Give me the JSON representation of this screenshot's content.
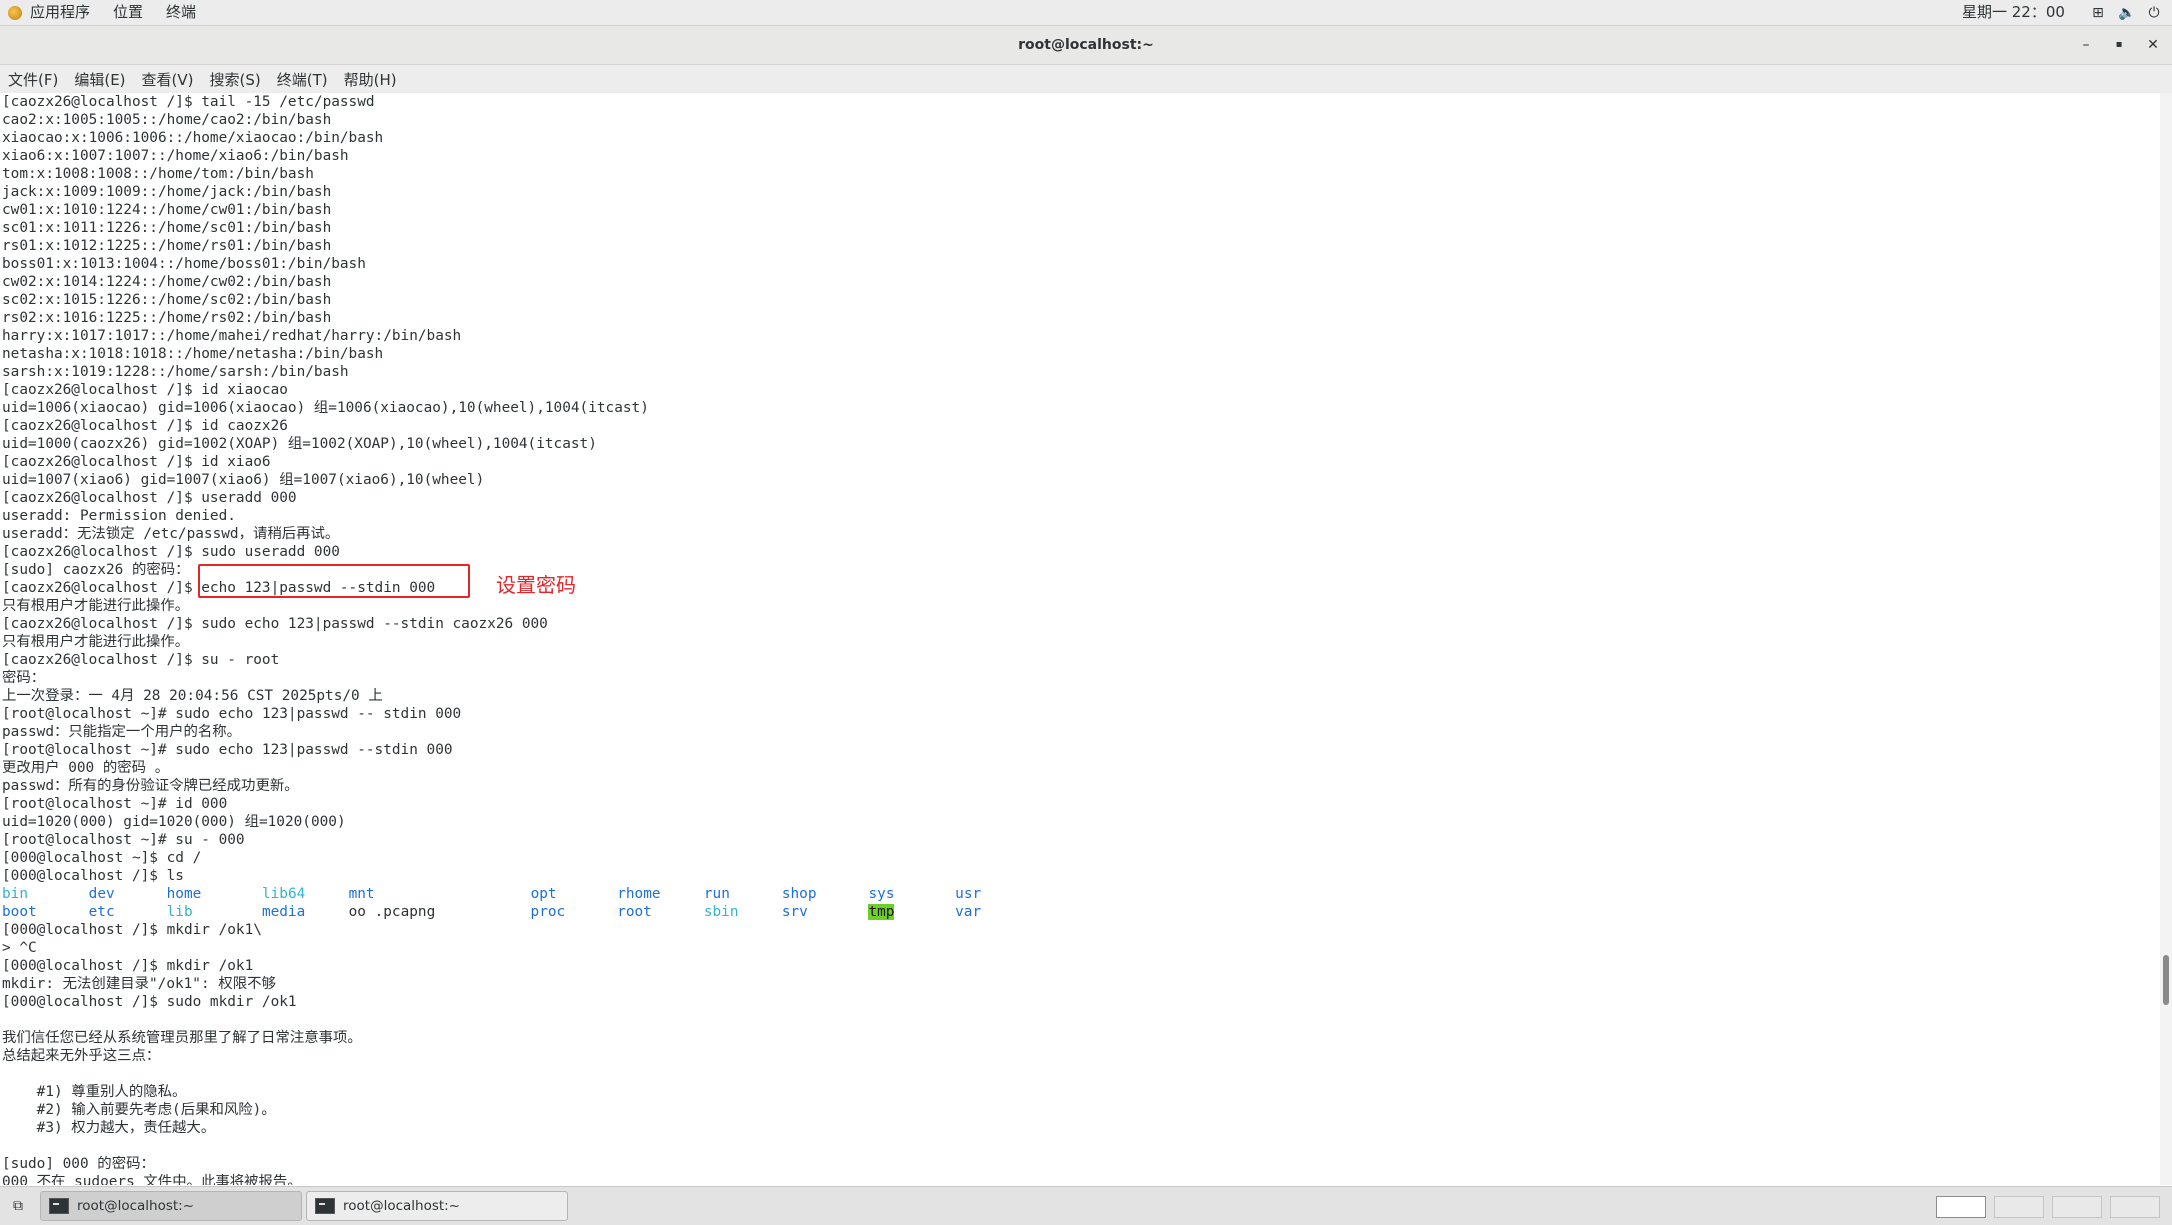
{
  "topbar": {
    "apps_label": "应用程序",
    "places_label": "位置",
    "terminal_label": "终端",
    "clock": "星期一 22：00",
    "tray_icons": [
      "network-icon",
      "volume-icon",
      "power-icon"
    ]
  },
  "window": {
    "title": "root@localhost:~",
    "buttons": {
      "minimize": "–",
      "maximize": "▪",
      "close": "✕"
    }
  },
  "menubar": {
    "items": [
      "文件(F)",
      "编辑(E)",
      "查看(V)",
      "搜索(S)",
      "终端(T)",
      "帮助(H)"
    ]
  },
  "terminal": {
    "lines_before_ls": [
      "[caozx26@localhost /]$ tail -15 /etc/passwd",
      "cao2:x:1005:1005::/home/cao2:/bin/bash",
      "xiaocao:x:1006:1006::/home/xiaocao:/bin/bash",
      "xiao6:x:1007:1007::/home/xiao6:/bin/bash",
      "tom:x:1008:1008::/home/tom:/bin/bash",
      "jack:x:1009:1009::/home/jack:/bin/bash",
      "cw01:x:1010:1224::/home/cw01:/bin/bash",
      "sc01:x:1011:1226::/home/sc01:/bin/bash",
      "rs01:x:1012:1225::/home/rs01:/bin/bash",
      "boss01:x:1013:1004::/home/boss01:/bin/bash",
      "cw02:x:1014:1224::/home/cw02:/bin/bash",
      "sc02:x:1015:1226::/home/sc02:/bin/bash",
      "rs02:x:1016:1225::/home/rs02:/bin/bash",
      "harry:x:1017:1017::/home/mahei/redhat/harry:/bin/bash",
      "netasha:x:1018:1018::/home/netasha:/bin/bash",
      "sarsh:x:1019:1228::/home/sarsh:/bin/bash",
      "[caozx26@localhost /]$ id xiaocao",
      "uid=1006(xiaocao) gid=1006(xiaocao) 组=1006(xiaocao),10(wheel),1004(itcast)",
      "[caozx26@localhost /]$ id caozx26",
      "uid=1000(caozx26) gid=1002(XOAP) 组=1002(XOAP),10(wheel),1004(itcast)",
      "[caozx26@localhost /]$ id xiao6",
      "uid=1007(xiao6) gid=1007(xiao6) 组=1007(xiao6),10(wheel)",
      "[caozx26@localhost /]$ useradd 000",
      "useradd: Permission denied.",
      "useradd：无法锁定 /etc/passwd，请稍后再试。",
      "[caozx26@localhost /]$ sudo useradd 000",
      "[sudo] caozx26 的密码：",
      "[caozx26@localhost /]$ echo 123|passwd --stdin 000",
      "只有根用户才能进行此操作。",
      "[caozx26@localhost /]$ sudo echo 123|passwd --stdin caozx26 000",
      "只有根用户才能进行此操作。",
      "[caozx26@localhost /]$ su - root",
      "密码：",
      "上一次登录：一 4月 28 20:04:56 CST 2025pts/0 上",
      "[root@localhost ~]# sudo echo 123|passwd -- stdin 000",
      "passwd：只能指定一个用户的名称。",
      "[root@localhost ~]# sudo echo 123|passwd --stdin 000",
      "更改用户 000 的密码 。",
      "passwd：所有的身份验证令牌已经成功更新。",
      "[root@localhost ~]# id 000",
      "uid=1020(000) gid=1020(000) 组=1020(000)",
      "[root@localhost ~]# su - 000",
      "[000@localhost ~]$ cd /",
      "[000@localhost /]$ ls"
    ],
    "ls_row1": [
      {
        "name": "bin",
        "kind": "link"
      },
      {
        "name": "dev",
        "kind": "dir"
      },
      {
        "name": "home",
        "kind": "dir"
      },
      {
        "name": "lib64",
        "kind": "link"
      },
      {
        "name": "mnt",
        "kind": "dir"
      },
      {
        "name": "opt",
        "kind": "dir"
      },
      {
        "name": "rhome",
        "kind": "dir"
      },
      {
        "name": "run",
        "kind": "dir"
      },
      {
        "name": "shop",
        "kind": "dir"
      },
      {
        "name": "sys",
        "kind": "dir"
      },
      {
        "name": "usr",
        "kind": "dir"
      }
    ],
    "ls_row2": [
      {
        "name": "boot",
        "kind": "dir"
      },
      {
        "name": "etc",
        "kind": "dir"
      },
      {
        "name": "lib",
        "kind": "link"
      },
      {
        "name": "media",
        "kind": "dir"
      },
      {
        "name": "oo .pcapng",
        "kind": "plain"
      },
      {
        "name": "proc",
        "kind": "dir"
      },
      {
        "name": "root",
        "kind": "dir"
      },
      {
        "name": "sbin",
        "kind": "link"
      },
      {
        "name": "srv",
        "kind": "dir"
      },
      {
        "name": "tmp",
        "kind": "sticky"
      },
      {
        "name": "var",
        "kind": "dir"
      }
    ],
    "lines_after_ls": [
      "[000@localhost /]$ mkdir /ok1\\",
      "> ^C",
      "[000@localhost /]$ mkdir /ok1",
      "mkdir: 无法创建目录\"/ok1\": 权限不够",
      "[000@localhost /]$ sudo mkdir /ok1",
      "",
      "我们信任您已经从系统管理员那里了解了日常注意事项。",
      "总结起来无外乎这三点：",
      "",
      "    #1) 尊重别人的隐私。",
      "    #2) 输入前要先考虑(后果和风险)。",
      "    #3) 权力越大，责任越大。",
      "",
      "[sudo] 000 的密码：",
      "000 不在 sudoers 文件中。此事将被报告。"
    ]
  },
  "annotation": {
    "label": "设置密码",
    "color": "#e3262a"
  },
  "taskbar": {
    "tasks": [
      "root@localhost:~",
      "root@localhost:~"
    ],
    "workspaces": 4,
    "active_workspace": 1
  },
  "colors": {
    "dir": "#1e6fd9",
    "link": "#34b3c9",
    "sticky_bg": "#6fcf2a"
  }
}
